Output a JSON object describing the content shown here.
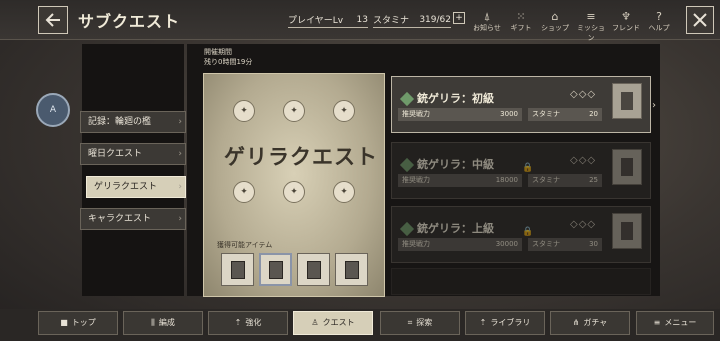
{
  "header": {
    "title": "サブクエスト",
    "player_label": "プレイヤーLv",
    "player_level": "13",
    "stamina_label": "スタミナ",
    "stamina_value": "319/62",
    "plus": "+",
    "nav": [
      {
        "icon": "bell-icon",
        "label": "お知らせ",
        "glyph": "⍋"
      },
      {
        "icon": "gift-icon",
        "label": "ギフト",
        "glyph": "⁙"
      },
      {
        "icon": "shop-icon",
        "label": "ショップ",
        "glyph": "⌂"
      },
      {
        "icon": "mission-icon",
        "label": "ミッション",
        "glyph": "≡"
      },
      {
        "icon": "friend-icon",
        "label": "フレンド",
        "glyph": "♆"
      },
      {
        "icon": "help-icon",
        "label": "ヘルプ",
        "glyph": "?"
      }
    ]
  },
  "emblem": "A",
  "tabs": [
    {
      "label": "記録：輪廻の檻",
      "active": false
    },
    {
      "label": "曜日クエスト",
      "active": false
    },
    {
      "label": "ゲリラクエスト",
      "active": true
    },
    {
      "label": "キャラクエスト",
      "active": false
    }
  ],
  "period": {
    "label": "開催期間",
    "remaining": "残り0時間19分"
  },
  "banner": {
    "title": "ゲリラクエスト",
    "items_label": "獲得可能アイテム"
  },
  "quests": [
    {
      "name": "銃ゲリラ：初級",
      "power_label": "推奨戦力",
      "power": "3000",
      "stamina_label": "スタミナ",
      "stamina": "20",
      "diamonds": "◇◇◇",
      "locked": false
    },
    {
      "name": "銃ゲリラ：中級",
      "power_label": "推奨戦力",
      "power": "18000",
      "stamina_label": "スタミナ",
      "stamina": "25",
      "diamonds": "◇◇◇",
      "locked": true
    },
    {
      "name": "銃ゲリラ：上級",
      "power_label": "推奨戦力",
      "power": "30000",
      "stamina_label": "スタミナ",
      "stamina": "30",
      "diamonds": "◇◇◇",
      "locked": true
    }
  ],
  "bottom_nav": [
    {
      "label": "トップ",
      "glyph": "■",
      "active": false
    },
    {
      "label": "編成",
      "glyph": "⫼",
      "active": false
    },
    {
      "label": "強化",
      "glyph": "⇡",
      "active": false
    },
    {
      "label": "クエスト",
      "glyph": "♙",
      "active": true
    },
    {
      "label": "探索",
      "glyph": "⌗",
      "active": false
    },
    {
      "label": "ライブラリ",
      "glyph": "⇡",
      "active": false
    },
    {
      "label": "ガチャ",
      "glyph": "⋔",
      "active": false
    },
    {
      "label": "メニュー",
      "glyph": "≡",
      "active": false
    }
  ],
  "colors": {
    "accent": "#d6cfb8",
    "gem": "#6f9a6a"
  }
}
